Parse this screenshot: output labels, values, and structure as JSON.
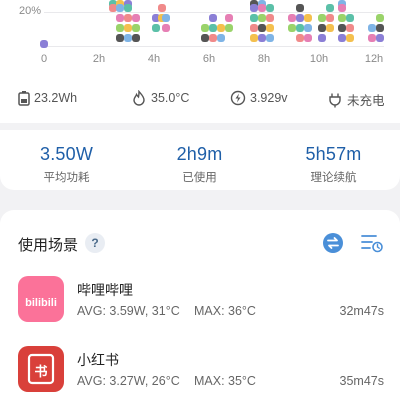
{
  "chart": {
    "y_label": "20%",
    "x_labels": [
      "0",
      "2h",
      "4h",
      "6h",
      "8h",
      "10h",
      "12h"
    ]
  },
  "stats": {
    "capacity": "23.2Wh",
    "temperature": "35.0°C",
    "voltage": "3.929v",
    "charging": "未充电"
  },
  "summary": {
    "avg_power": {
      "value": "3.50W",
      "label": "平均功耗"
    },
    "used": {
      "value": "2h9m",
      "label": "已使用"
    },
    "remaining": {
      "value": "5h57m",
      "label": "理论续航"
    }
  },
  "scenes": {
    "title": "使用场景",
    "help": "?",
    "apps": [
      {
        "name": "哔哩哔哩",
        "avg": "AVG: 3.59W, 31°C",
        "max": "MAX:  36°C",
        "duration": "32m47s",
        "icon_text": "bilibili"
      },
      {
        "name": "小红书",
        "avg": "AVG: 3.27W, 26°C",
        "max": "MAX:  35°C",
        "duration": "35m47s",
        "icon_text": "书"
      }
    ]
  },
  "colors": {
    "accent": "#1f5fa8",
    "bilibili": "#fb7299",
    "xiaohongshu": "#d9403a"
  },
  "icons": [
    "battery-icon",
    "thermometer-icon",
    "voltage-icon",
    "plug-icon",
    "help-icon",
    "swap-icon",
    "sort-icon"
  ]
}
